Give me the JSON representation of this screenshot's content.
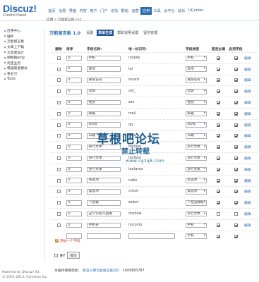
{
  "app": {
    "logo_title": "Discuz!",
    "logo_subtitle": "Control Panel",
    "breadcrumb": "应用 » 万能留言板 [+]"
  },
  "topnav": [
    "首页",
    "全局",
    "界面",
    "内容",
    "用户",
    "门户",
    "论坛",
    "群组",
    "运营",
    "应用",
    "工具",
    "云平台",
    "站长",
    "UCenter"
  ],
  "topnav_active_index": 9,
  "sidebar": {
    "items": [
      "应用中心",
      "插件",
      "万能留言板",
      "文章上下载",
      "文章量设计",
      "把把把ping",
      "淘宝业务",
      "畅通渠道模式",
      "各业只",
      "Tools"
    ]
  },
  "footer_left": {
    "line1": "Powered by Discuz! X3",
    "line2": "© 2001-2013, Comsenz Inc."
  },
  "plugin": {
    "title": "万能留言板 1.0",
    "tabs": [
      "设置",
      "表单生成",
      "帮助说明设置",
      "留言管理"
    ],
    "active_tab_index": 1
  },
  "table": {
    "headers": {
      "del": "删除",
      "sort": "排序",
      "name": "字段名称:",
      "id": "唯一标识符:",
      "type": "字段类型",
      "required": "是否必填",
      "enabled": "启用字段"
    },
    "op_label": "编辑",
    "rows": [
      {
        "sort": "0",
        "name": "手机",
        "id": "mobile",
        "type": "手机",
        "req": true,
        "en": true
      },
      {
        "sort": "0",
        "name": "固话",
        "id": "tel",
        "type": "固话",
        "req": true,
        "en": true
      },
      {
        "sort": "0",
        "name": "身份证号",
        "id": "idcard",
        "type": "身份证号",
        "req": true,
        "en": true
      },
      {
        "sort": "0",
        "name": "年龄",
        "id": "old_",
        "type": "年龄",
        "req": true,
        "en": true
      },
      {
        "sort": "0",
        "name": "性别",
        "id": "sex",
        "type": "性别",
        "req": true,
        "en": true
      },
      {
        "sort": "0",
        "name": "邮箱",
        "id": "mail",
        "type": "邮箱",
        "req": true,
        "en": true
      },
      {
        "sort": "0",
        "name": "QQ号",
        "id": "qq",
        "type": "QQ号",
        "req": true,
        "en": true
      },
      {
        "sort": "0",
        "name": "日期",
        "id": "date",
        "type": "日期",
        "req": true,
        "en": true
      },
      {
        "sort": "0",
        "name": "单行文本",
        "id": "textline",
        "type": "单行文本",
        "req": true,
        "en": true
      },
      {
        "sort": "0",
        "name": "多行文本",
        "id": "textbox",
        "type": "多行文本",
        "req": true,
        "en": true
      },
      {
        "sort": "0",
        "name": "多行文本",
        "id": "textarea",
        "type": "多行文本",
        "req": true,
        "en": true
      },
      {
        "sort": "0",
        "name": "单选项",
        "id": "radio",
        "type": "单选项",
        "req": true,
        "en": true
      },
      {
        "sort": "0",
        "name": "复选项",
        "id": "check",
        "type": "复选项",
        "req": true,
        "en": true
      },
      {
        "sort": "0",
        "name": "下拉框",
        "id": "select",
        "type": "下拉选择框",
        "req": true,
        "en": true
      },
      {
        "sort": "0",
        "name": "这个字段不启用",
        "id": "noshow",
        "type": "单行文本",
        "req": false,
        "en": false
      },
      {
        "sort": "0",
        "name": "手机号",
        "id": "nocomp",
        "type": "手机",
        "req": true,
        "en": true
      },
      {
        "sort": "",
        "name": "",
        "id": "",
        "type": "手机",
        "req": true,
        "en": true,
        "blank": true
      }
    ]
  },
  "add_field_label": "添加一个字段",
  "delete_label": "删?",
  "submit_label": "提交",
  "footer_main": {
    "prefix": "本插件使用帮助：",
    "link": "我怎么用万能留言板QQ：",
    "qq": "1609883787"
  },
  "watermark": {
    "main": "草根吧论坛",
    "sub": "禁止转载",
    "url": "www.cgzq8.com"
  },
  "colors": {
    "brand": "#2b69b4",
    "active_tab": "#1d5296",
    "add_icon": "#e67e22",
    "add_text": "#c0392b"
  }
}
